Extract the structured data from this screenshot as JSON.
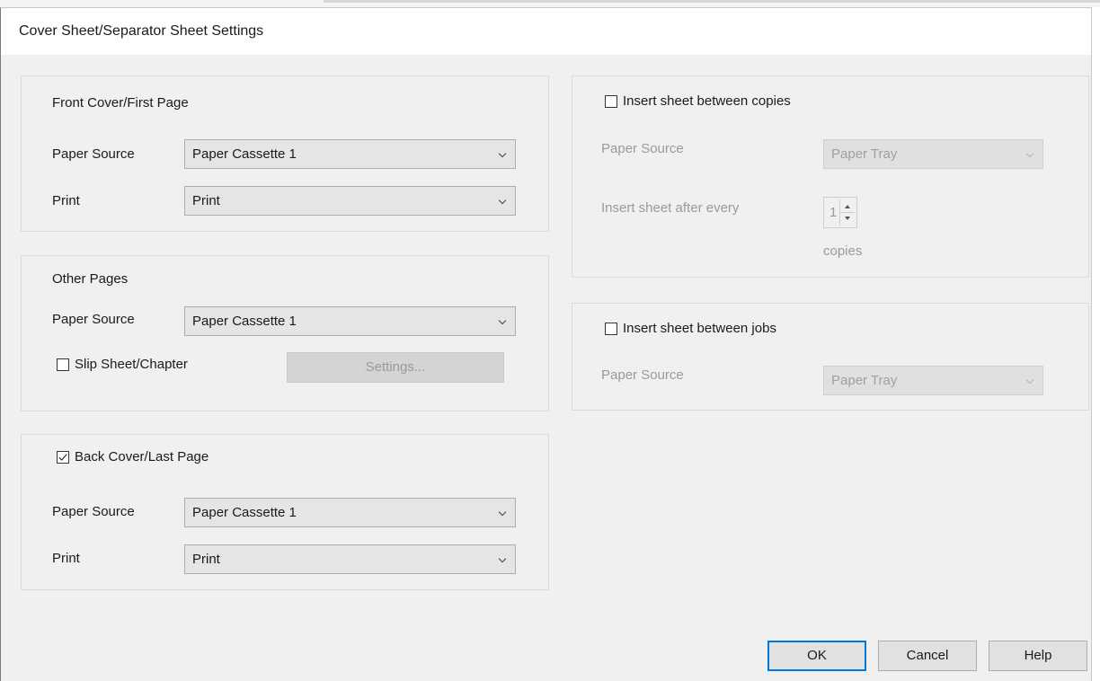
{
  "dialog": {
    "title": "Cover Sheet/Separator Sheet Settings"
  },
  "front_cover": {
    "heading": "Front Cover/First Page",
    "paper_source_label": "Paper Source",
    "paper_source_value": "Paper Cassette 1",
    "print_label": "Print",
    "print_value": "Print"
  },
  "other_pages": {
    "heading": "Other Pages",
    "paper_source_label": "Paper Source",
    "paper_source_value": "Paper Cassette 1",
    "slip_sheet_label": "Slip Sheet/Chapter",
    "slip_sheet_checked": false,
    "settings_button": "Settings..."
  },
  "back_cover": {
    "checkbox_label": "Back Cover/Last Page",
    "checked": true,
    "paper_source_label": "Paper Source",
    "paper_source_value": "Paper Cassette 1",
    "print_label": "Print",
    "print_value": "Print"
  },
  "between_copies": {
    "checkbox_label": "Insert sheet between copies",
    "checked": false,
    "paper_source_label": "Paper Source",
    "paper_source_value": "Paper Tray",
    "after_every_label": "Insert sheet after every",
    "after_every_value": "1",
    "copies_label": "copies"
  },
  "between_jobs": {
    "checkbox_label": "Insert sheet between jobs",
    "checked": false,
    "paper_source_label": "Paper Source",
    "paper_source_value": "Paper Tray"
  },
  "buttons": {
    "ok": "OK",
    "cancel": "Cancel",
    "help": "Help"
  },
  "colors": {
    "accent": "#0078d7",
    "dialog_bg": "#f0f0f0",
    "disabled_text": "#9a9a9a"
  },
  "icons": {
    "dropdown": "chevron-down-icon",
    "check": "checkmark-icon",
    "spin_up": "caret-up-icon",
    "spin_down": "caret-down-icon"
  }
}
